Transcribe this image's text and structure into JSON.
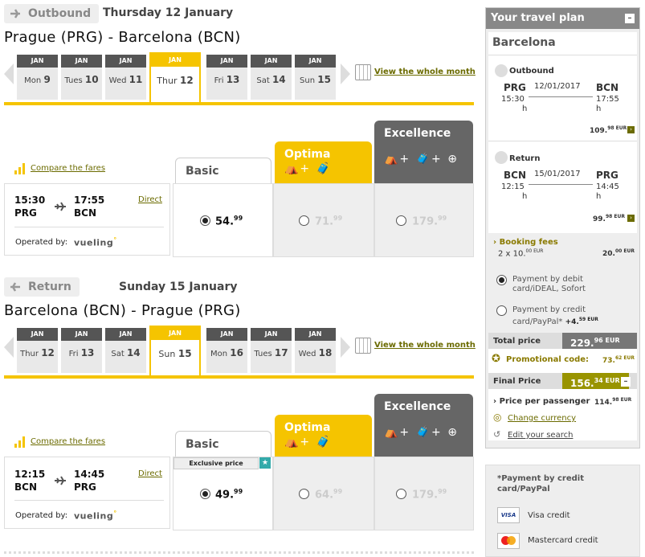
{
  "outbound": {
    "label": "Outbound",
    "date": "Thursday 12 January",
    "route": "Prague (PRG) - Barcelona (BCN)",
    "days": [
      {
        "month": "JAN",
        "dow": "Mon",
        "day": "9"
      },
      {
        "month": "JAN",
        "dow": "Tues",
        "day": "10"
      },
      {
        "month": "JAN",
        "dow": "Wed",
        "day": "11"
      },
      {
        "month": "JAN",
        "dow": "Thur",
        "day": "12"
      },
      {
        "month": "JAN",
        "dow": "Fri",
        "day": "13"
      },
      {
        "month": "JAN",
        "dow": "Sat",
        "day": "14"
      },
      {
        "month": "JAN",
        "dow": "Sun",
        "day": "15"
      }
    ],
    "view_month": "View the whole month",
    "compare": "Compare the fares",
    "dep_time": "15:30",
    "dep_code": "PRG",
    "arr_time": "17:55",
    "arr_code": "BCN",
    "direct": "Direct",
    "operated_by": "Operated by:",
    "airline": "vueling",
    "fares": {
      "basic": {
        "name": "Basic",
        "int": "54.",
        "dec": "99"
      },
      "optima": {
        "name": "Optima",
        "int": "71.",
        "dec": "99"
      },
      "excellence": {
        "name": "Excellence",
        "int": "179.",
        "dec": "99"
      }
    }
  },
  "return": {
    "label": "Return",
    "date": "Sunday 15 January",
    "route": "Barcelona (BCN) - Prague (PRG)",
    "days": [
      {
        "month": "JAN",
        "dow": "Thur",
        "day": "12"
      },
      {
        "month": "JAN",
        "dow": "Fri",
        "day": "13"
      },
      {
        "month": "JAN",
        "dow": "Sat",
        "day": "14"
      },
      {
        "month": "JAN",
        "dow": "Sun",
        "day": "15"
      },
      {
        "month": "JAN",
        "dow": "Mon",
        "day": "16"
      },
      {
        "month": "JAN",
        "dow": "Tues",
        "day": "17"
      },
      {
        "month": "JAN",
        "dow": "Wed",
        "day": "18"
      }
    ],
    "view_month": "View the whole month",
    "compare": "Compare the fares",
    "dep_time": "12:15",
    "dep_code": "BCN",
    "arr_time": "14:45",
    "arr_code": "PRG",
    "direct": "Direct",
    "operated_by": "Operated by:",
    "airline": "vueling",
    "exclusive": "Exclusive price",
    "fares": {
      "basic": {
        "name": "Basic",
        "int": "49.",
        "dec": "99"
      },
      "optima": {
        "name": "Optima",
        "int": "64.",
        "dec": "99"
      },
      "excellence": {
        "name": "Excellence",
        "int": "179.",
        "dec": "99"
      }
    }
  },
  "sidebar": {
    "title": "Your travel plan",
    "minimize": "–",
    "destination": "Barcelona",
    "outbound": {
      "label": "Outbound",
      "from": "PRG",
      "from_time": "15:30",
      "from_h": "h",
      "date": "12/01/2017",
      "to": "BCN",
      "to_time": "17:55",
      "to_h": "h",
      "price_int": "109.",
      "price_dec": "98 EUR"
    },
    "return": {
      "label": "Return",
      "from": "BCN",
      "from_time": "12:15",
      "from_h": "h",
      "date": "15/01/2017",
      "to": "PRG",
      "to_time": "14:45",
      "to_h": "h",
      "price_int": "99.",
      "price_dec": "98 EUR"
    },
    "booking_fees": "Booking fees",
    "fees_calc": "2 x 10.",
    "fees_calc_dec": "00 EUR",
    "fees_int": "20.",
    "fees_dec": "00 EUR",
    "pay_debit": "Payment by debit card/iDEAL, Sofort",
    "pay_credit_a": "Payment by credit card/PayPal*",
    "pay_credit_fee": "+4.",
    "pay_credit_fee_dec": "59 EUR",
    "total_label": "Total price",
    "total_int": "229.",
    "total_dec": "96 EUR",
    "promo_label": "Promotional code:",
    "promo_int": "73.",
    "promo_dec": "62 EUR",
    "final_label": "Final Price",
    "final_int": "156.",
    "final_dec": "34 EUR",
    "per_passenger_label": "Price per passenger",
    "per_int": "114.",
    "per_dec": "98 EUR",
    "change_currency": "Change currency",
    "edit_search": "Edit your search"
  },
  "cards": {
    "title": "*Payment by credit card/PayPal",
    "visa": "Visa credit",
    "visa_logo": "VISA",
    "mastercard": "Mastercard credit"
  },
  "colors": {
    "accent": "#f5c400",
    "dark": "#666666",
    "olive": "#6b6b00"
  }
}
